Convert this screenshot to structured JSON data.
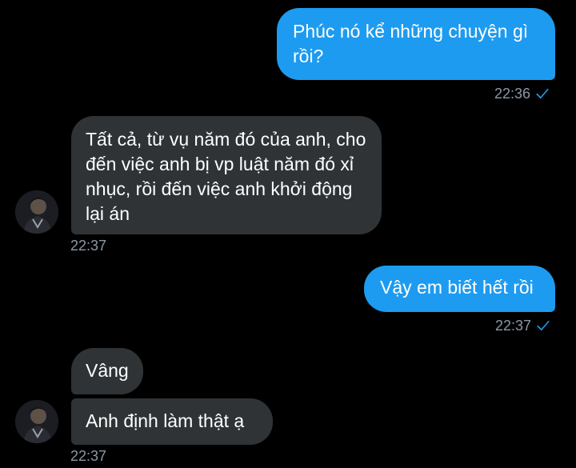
{
  "messages": [
    {
      "text": "Phúc nó kể những chuyện gì rồi?",
      "time": "22:36",
      "direction": "out",
      "read_icon": "check-icon"
    },
    {
      "text": "Tất cả, từ vụ năm đó của anh, cho đến việc anh bị vp luật năm đó xỉ nhục, rồi đến việc anh khởi động lại án",
      "time": "22:37",
      "direction": "in"
    },
    {
      "text": "Vậy em biết hết rồi",
      "time": "22:37",
      "direction": "out",
      "read_icon": "check-icon"
    },
    {
      "text": "Vâng",
      "direction": "in"
    },
    {
      "text": "Anh định làm thật ạ",
      "time": "22:37",
      "direction": "in"
    }
  ],
  "colors": {
    "background": "#000000",
    "outgoing_bubble": "#1d9bf0",
    "incoming_bubble": "#2f3336",
    "timestamp": "#8b98a5",
    "check": "#1d9bf0"
  }
}
